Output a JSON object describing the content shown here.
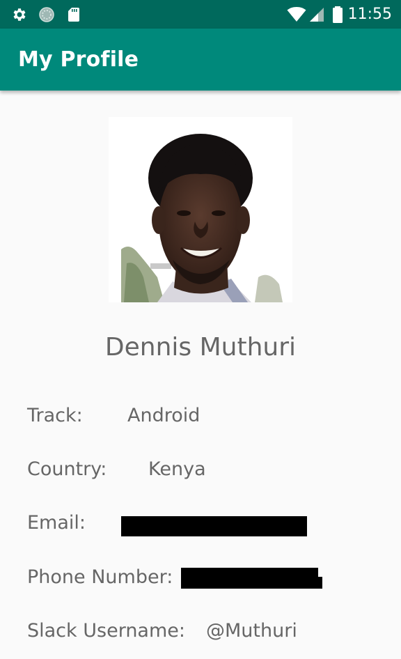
{
  "status_bar": {
    "time": "11:55",
    "left_icons": [
      "gear-icon",
      "sync-circle-icon",
      "sd-card-icon"
    ],
    "right_icons": [
      "wifi-icon",
      "cell-signal-icon",
      "battery-icon"
    ]
  },
  "app_bar": {
    "title": "My Profile",
    "color": "#00897b",
    "status_color": "#00695c"
  },
  "profile": {
    "photo": "profile-photo",
    "name": "Dennis Muthuri",
    "fields": [
      {
        "label": "Track:",
        "value": "Android"
      },
      {
        "label": "Country:",
        "value": "Kenya"
      },
      {
        "label": "Email:",
        "value": "",
        "redacted": true
      },
      {
        "label": "Phone Number:",
        "value": "",
        "redacted": true
      },
      {
        "label": "Slack Username:",
        "value": "@Muthuri"
      }
    ]
  }
}
